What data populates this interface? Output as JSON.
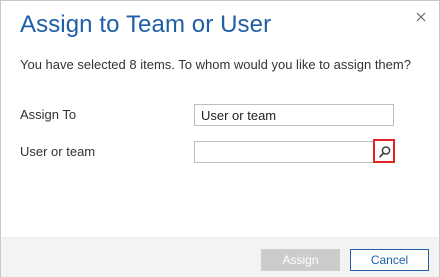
{
  "dialog": {
    "title": "Assign to Team or User",
    "message": "You have selected 8 items. To whom would you like to assign them?",
    "close_icon": "close-icon"
  },
  "form": {
    "assign_to_label": "Assign To",
    "assign_to_value": "User or team",
    "user_or_team_label": "User or team",
    "user_or_team_value": "",
    "lookup_icon": "search-icon"
  },
  "footer": {
    "assign_label": "Assign",
    "cancel_label": "Cancel"
  },
  "colors": {
    "title": "#1f5fa8",
    "highlight": "#e02424",
    "disabled_button": "#cccccc",
    "footer_bg": "#f3f3f3"
  }
}
